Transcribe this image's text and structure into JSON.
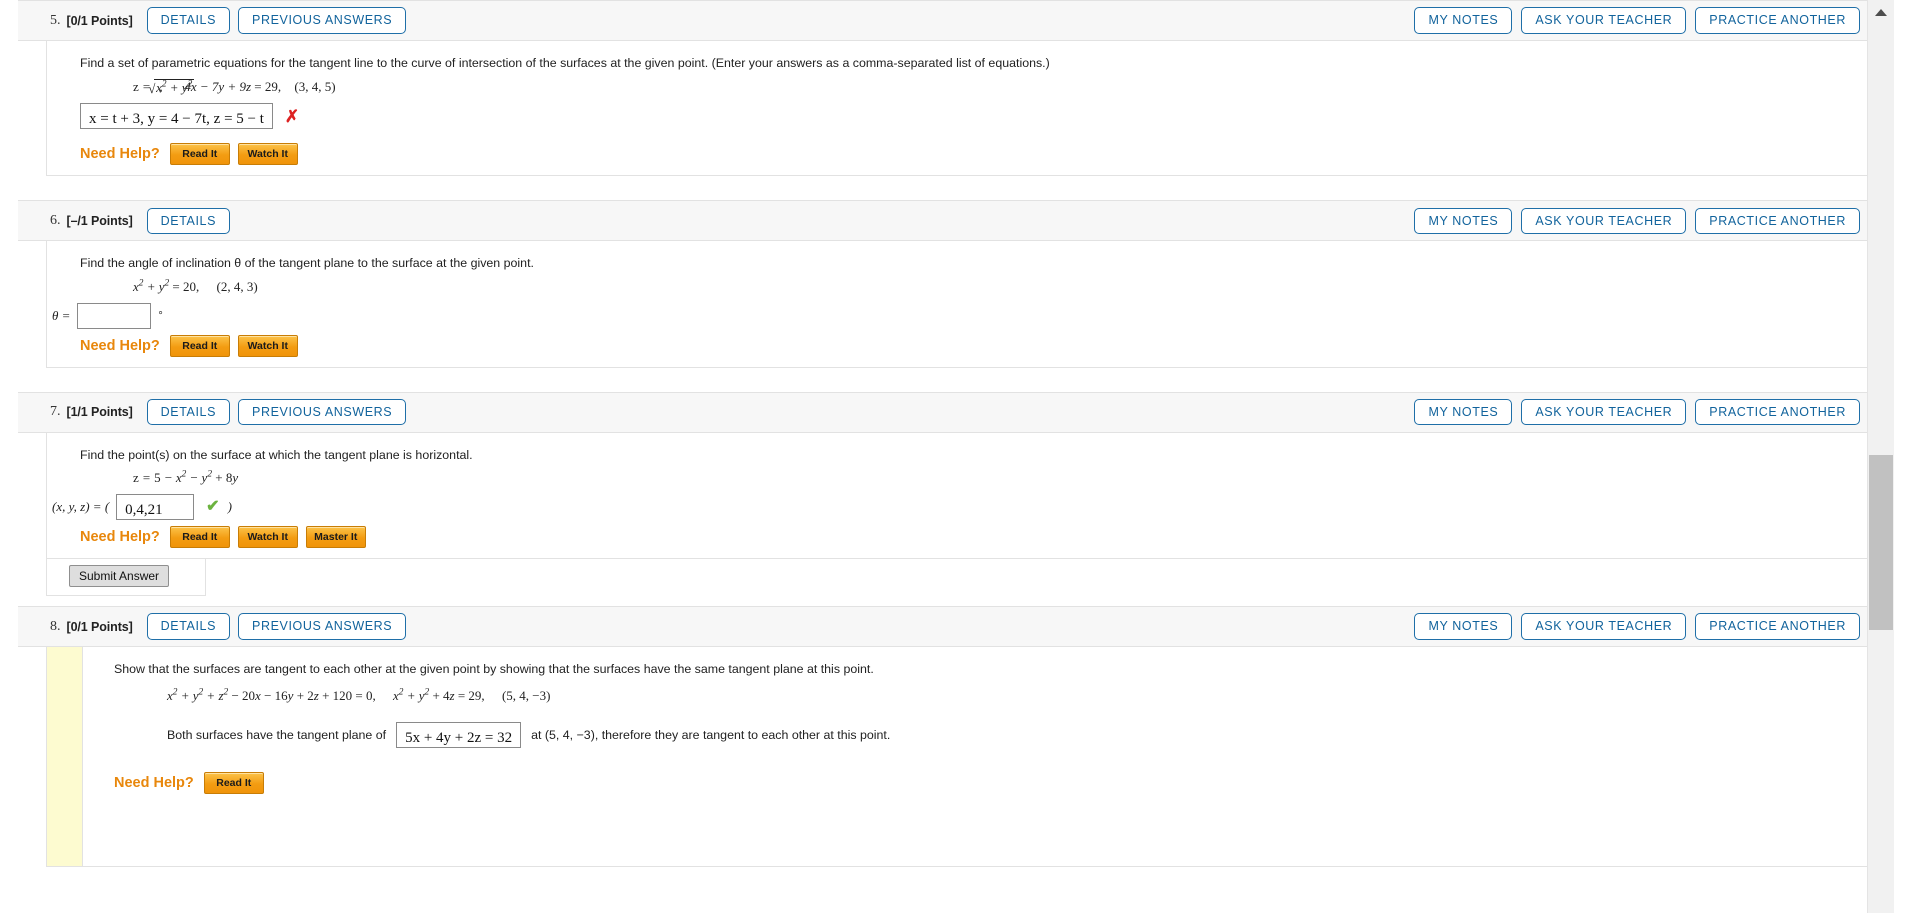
{
  "header_buttons": {
    "details": "DETAILS",
    "previous_answers": "PREVIOUS ANSWERS",
    "my_notes": "MY NOTES",
    "ask_your_teacher": "ASK YOUR TEACHER",
    "practice_another": "PRACTICE ANOTHER"
  },
  "need_help": {
    "label": "Need Help?",
    "read_it": "Read It",
    "watch_it": "Watch It",
    "master_it": "Master It"
  },
  "submit": {
    "label": "Submit Answer"
  },
  "marks": {
    "wrong": "✗",
    "right": "✔"
  },
  "questions": [
    {
      "number": "5.",
      "points": "[0/1 Points]",
      "prompt": "Find a set of parametric equations for the tangent line to the curve of intersection of the surfaces at the given point. (Enter your answers as a comma-separated list of equations.)",
      "equation_plain": "z = √(x² + y²),   4x − 7y + 9z = 29,   (3, 4, 5)",
      "answer_value": "x = t + 3, y = 4 − 7t, z = 5 − t",
      "answer_status": "incorrect",
      "has_previous_answers": true,
      "help_buttons": [
        "Read It",
        "Watch It"
      ],
      "answer_label": ""
    },
    {
      "number": "6.",
      "points": "[–/1 Points]",
      "prompt": "Find the angle of inclination θ of the tangent plane to the surface at the given point.",
      "equation_plain": "x² + y² = 20,   (2, 4, 3)",
      "answer_value": "",
      "answer_status": "none",
      "has_previous_answers": false,
      "help_buttons": [
        "Read It",
        "Watch It"
      ],
      "answer_label": "θ =",
      "answer_unit": "°"
    },
    {
      "number": "7.",
      "points": "[1/1 Points]",
      "prompt": "Find the point(s) on the surface at which the tangent plane is horizontal.",
      "equation_plain": "z = 5 − x² − y² + 8y",
      "answer_value": "0,4,21",
      "answer_status": "correct",
      "has_previous_answers": true,
      "help_buttons": [
        "Read It",
        "Watch It",
        "Master It"
      ],
      "answer_label": "(x, y, z) = (",
      "answer_suffix": ")"
    },
    {
      "number": "8.",
      "points": "[0/1 Points]",
      "prompt": "Show that the surfaces are tangent to each other at the given point by showing that the surfaces have the same tangent plane at this point.",
      "equation_plain": "x² + y² + z² − 20x − 16y + 2z + 120 = 0,   x² + y² + 4z = 29,   (5, 4, −3)",
      "sentence_before": "Both surfaces have the tangent plane of",
      "answer_value": "5x + 4y + 2z = 32",
      "sentence_after": "at (5, 4, −3), therefore they are tangent to each other at this point.",
      "answer_status": "none",
      "has_previous_answers": true,
      "help_buttons": [
        "Read It"
      ],
      "highlighted": true
    }
  ]
}
